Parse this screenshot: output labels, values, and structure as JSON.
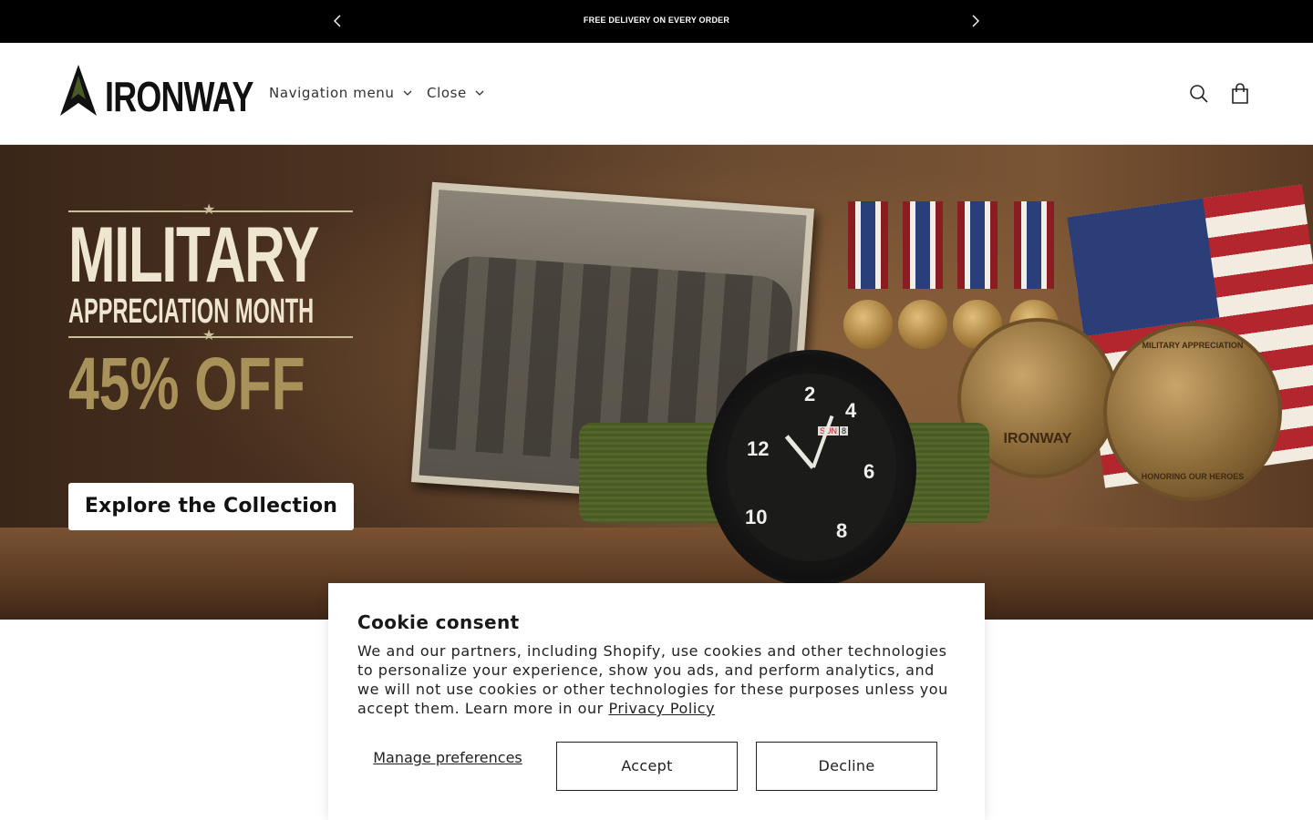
{
  "announcement": {
    "message": "FREE DELIVERY ON EVERY ORDER",
    "prev_icon": "chevron-left-icon",
    "next_icon": "chevron-right-icon"
  },
  "header": {
    "logo_text": "IRONWAY",
    "nav": [
      {
        "label": "Navigation menu",
        "icon": "chevron-down-icon"
      },
      {
        "label": "Close",
        "icon": "chevron-down-icon"
      }
    ],
    "icons": [
      "search-icon",
      "cart-icon"
    ]
  },
  "hero": {
    "headline": "MILITARY",
    "subheadline": "APPRECIATION MONTH",
    "offer": "45% OFF",
    "cta_label": "Explore the Collection",
    "coin_left_text": "IRONWAY",
    "coin_right_top": "MILITARY APPRECIATION",
    "coin_right_bottom": "HONORING OUR HEROES",
    "watch_day": "SUN",
    "watch_date": "8"
  },
  "cookie": {
    "title": "Cookie consent",
    "body": "We and our partners, including Shopify, use cookies and other technologies to personalize your experience, show you ads, and perform analytics, and we will not use cookies or other technologies for these purposes unless you accept them. Learn more in our ",
    "privacy_link": "Privacy Policy",
    "manage_label": "Manage preferences",
    "accept_label": "Accept",
    "decline_label": "Decline"
  },
  "colors": {
    "announcement_bg": "#000000",
    "hero_offer": "#a8925a",
    "hero_headline": "#efe6d0"
  }
}
